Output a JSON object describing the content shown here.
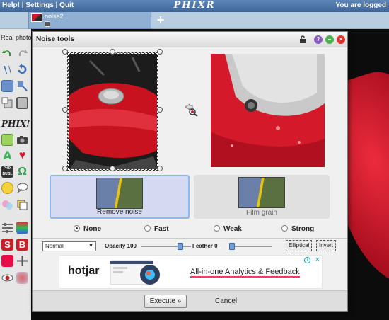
{
  "topbar": {
    "help": "Help!",
    "settings": "Settings",
    "quit": "Quit",
    "separator": " | ",
    "brand": "PHIXR",
    "status": "You are logged"
  },
  "tabs": {
    "document_name": "noise2",
    "add_symbol": "+"
  },
  "sidebar": {
    "section_label": "Real photo",
    "phix_label": "PHIX!"
  },
  "dialog": {
    "title": "Noise tools",
    "help_symbol": "?",
    "minimize_symbol": "–",
    "close_symbol": "×"
  },
  "filters": [
    {
      "label": "Remove noise",
      "selected": true
    },
    {
      "label": "Film grain",
      "selected": false
    }
  ],
  "strength": {
    "options": [
      "None",
      "Fast",
      "Weak",
      "Strong"
    ],
    "selected": "None"
  },
  "controls": {
    "blend_mode": "Normal",
    "opacity_label": "Opacity",
    "opacity_value": "100",
    "feather_label": "Feather",
    "feather_value": "0",
    "elliptical_label": "Elliptical",
    "invert_label": "Invert"
  },
  "ad": {
    "logo": "hotjar",
    "headline": "All-in-one Analytics & Feedback",
    "info_symbol": "i",
    "close_symbol": "×"
  },
  "footer": {
    "execute_label": "Execute »",
    "cancel_label": "Cancel"
  },
  "colors": {
    "accent": "#8fb7ea",
    "close_red": "#e0332e",
    "minimize_green": "#4caf50",
    "help_purple": "#8a5bbf"
  }
}
